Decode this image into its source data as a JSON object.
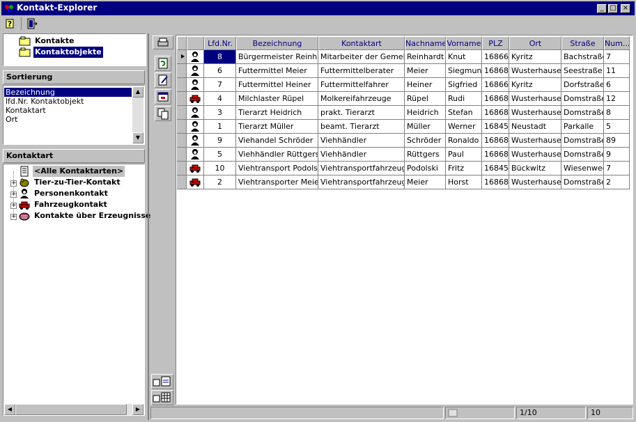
{
  "window": {
    "title": "Kontakt-Explorer"
  },
  "caption_buttons": {
    "minimize": "_",
    "maximize": "□",
    "close": "×"
  },
  "toolbar": {
    "help_icon": "help-icon",
    "exit_icon": "exit-icon"
  },
  "nav_tree": {
    "items": [
      {
        "label": "Kontakte",
        "selected": false
      },
      {
        "label": "Kontaktobjekte",
        "selected": true
      }
    ]
  },
  "sortierung": {
    "header": "Sortierung",
    "items": [
      {
        "label": "Bezeichnung",
        "selected": true
      },
      {
        "label": "lfd.Nr. Kontaktobjekt",
        "selected": false
      },
      {
        "label": "Kontaktart",
        "selected": false
      },
      {
        "label": "Ort",
        "selected": false
      }
    ]
  },
  "kontaktart": {
    "header": "Kontaktart",
    "items": [
      {
        "label": "<Alle Kontaktarten>",
        "expandable": false,
        "selected": true,
        "icon": "document-icon"
      },
      {
        "label": "Tier-zu-Tier-Kontakt",
        "expandable": true,
        "selected": false,
        "icon": "animal-icon"
      },
      {
        "label": "Personenkontakt",
        "expandable": true,
        "selected": false,
        "icon": "person-icon"
      },
      {
        "label": "Fahrzeugkontakt",
        "expandable": true,
        "selected": false,
        "icon": "car-icon"
      },
      {
        "label": "Kontakte über Erzeugnisse",
        "expandable": true,
        "selected": false,
        "icon": "product-icon"
      }
    ]
  },
  "table": {
    "columns": [
      "",
      "",
      "Lfd.Nr.",
      "Bezeichnung",
      "Kontaktart",
      "Nachname",
      "Vorname",
      "PLZ",
      "Ort",
      "Straße",
      "Num..."
    ],
    "rows": [
      {
        "icon": "person-icon",
        "nr": "8",
        "bez": "Bürgermeister Reinhardt",
        "art": "Mitarbeiter der Gemeinde",
        "nach": "Reinhardt",
        "vor": "Knut",
        "plz": "16866",
        "ort": "Kyritz",
        "str": "Bachstraße",
        "num": "7",
        "current": true
      },
      {
        "icon": "person-icon",
        "nr": "6",
        "bez": "Futtermittel Meier",
        "art": "Futtermittelberater",
        "nach": "Meier",
        "vor": "Siegmund",
        "plz": "16868",
        "ort": "Wusterhausen",
        "str": "Seestraße",
        "num": "11"
      },
      {
        "icon": "person-icon",
        "nr": "7",
        "bez": "Futtermittel Heiner",
        "art": "Futtermittelfahrer",
        "nach": "Heiner",
        "vor": "Sigfried",
        "plz": "16866",
        "ort": "Kyritz",
        "str": "Dorfstraße",
        "num": "6"
      },
      {
        "icon": "car-icon",
        "nr": "4",
        "bez": "Milchlaster Rüpel",
        "art": "Molkereifahrzeuge",
        "nach": "Rüpel",
        "vor": "Rudi",
        "plz": "16868",
        "ort": "Wusterhausen",
        "str": "Domstraße",
        "num": "12"
      },
      {
        "icon": "person-icon",
        "nr": "3",
        "bez": "Tierarzt Heidrich",
        "art": "prakt. Tierarzt",
        "nach": "Heidrich",
        "vor": "Stefan",
        "plz": "16868",
        "ort": "Wusterhausen",
        "str": "Domstraße",
        "num": "8"
      },
      {
        "icon": "person-icon",
        "nr": "1",
        "bez": "Tierarzt Müller",
        "art": "beamt. Tierarzt",
        "nach": "Müller",
        "vor": "Werner",
        "plz": "16845",
        "ort": "Neustadt",
        "str": "Parkalle",
        "num": "5"
      },
      {
        "icon": "person-icon",
        "nr": "9",
        "bez": "Viehandel Schröder",
        "art": "Viehhändler",
        "nach": "Schröder",
        "vor": "Ronaldo",
        "plz": "16868",
        "ort": "Wusterhausen",
        "str": "Domstraße",
        "num": "89"
      },
      {
        "icon": "person-icon",
        "nr": "5",
        "bez": "Viehhändler Rüttgers",
        "art": "Viehhändler",
        "nach": "Rüttgers",
        "vor": "Paul",
        "plz": "16868",
        "ort": "Wusterhausen",
        "str": "Domstraße",
        "num": "9"
      },
      {
        "icon": "car-icon",
        "nr": "10",
        "bez": "Viehtransport Podolski",
        "art": "Viehtransportfahrzeuge",
        "nach": "Podolski",
        "vor": "Fritz",
        "plz": "16845",
        "ort": "Bückwitz",
        "str": "Wiesenweg",
        "num": "7"
      },
      {
        "icon": "car-icon",
        "nr": "2",
        "bez": "Viehtransporter Meier",
        "art": "Viehtransportfahrzeuge",
        "nach": "Meier",
        "vor": "Horst",
        "plz": "16868",
        "ort": "Wusterhausen",
        "str": "Domstraße",
        "num": "2"
      }
    ]
  },
  "statusbar": {
    "position": "1/10",
    "count": "10"
  },
  "colors": {
    "title_bg": "#000080",
    "header_text": "#000080",
    "selection": "#000080",
    "window_bg": "#c0c0c0"
  }
}
